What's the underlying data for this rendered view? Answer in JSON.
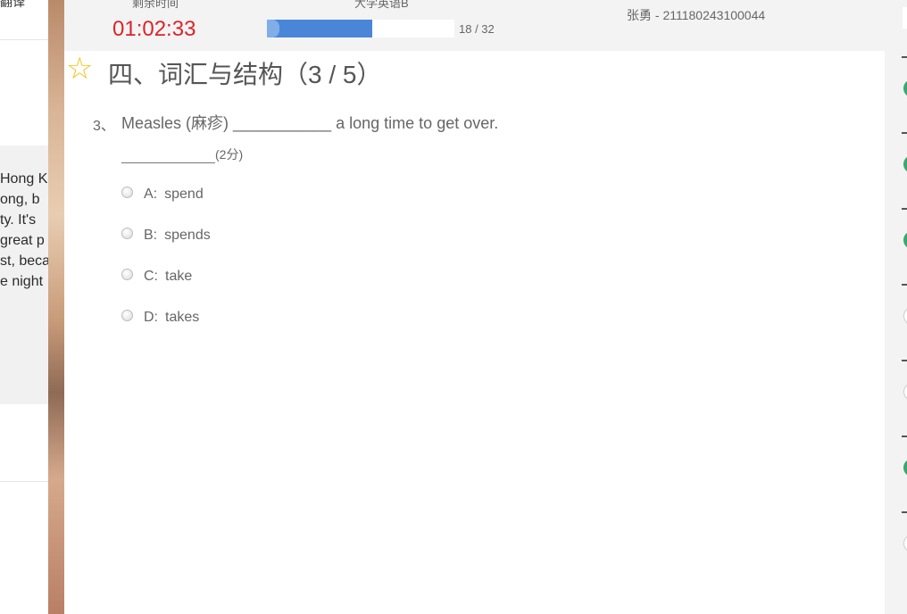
{
  "background_window": {
    "top_word": "翻译",
    "passage_lines": [
      "Hong K",
      "ong, b",
      "ty. It's",
      "great p",
      "st, beca",
      "e night"
    ]
  },
  "exam": {
    "header_labels": {
      "time_label": "剩余时间",
      "course_label": "大学英语B"
    },
    "timer": "01:02:33",
    "progress": {
      "current": 18,
      "total": 32,
      "text": "18 / 32",
      "fraction": 0.5625
    },
    "student": "张勇 - 211180243100044",
    "section_title": "四、词汇与结构（3 / 5）",
    "question": {
      "number": "3、",
      "text": "Measles (麻疹) ___________ a long time to get over.",
      "score": "(2分)"
    },
    "options": [
      {
        "letter": "A:",
        "text": "spend"
      },
      {
        "letter": "B:",
        "text": "spends"
      },
      {
        "letter": "C:",
        "text": "take"
      },
      {
        "letter": "D:",
        "text": "takes"
      }
    ]
  },
  "question_nav": {
    "statuses": [
      "done",
      "done",
      "done",
      "todo",
      "todo",
      "done",
      "todo"
    ]
  },
  "colors": {
    "timer": "#d9252a",
    "progress_fill": "#4a86d8",
    "star": "#f0c419",
    "answered": "#3aa76d"
  },
  "icons": {
    "star": "star-outline-icon",
    "radio": "radio-unchecked-icon"
  }
}
